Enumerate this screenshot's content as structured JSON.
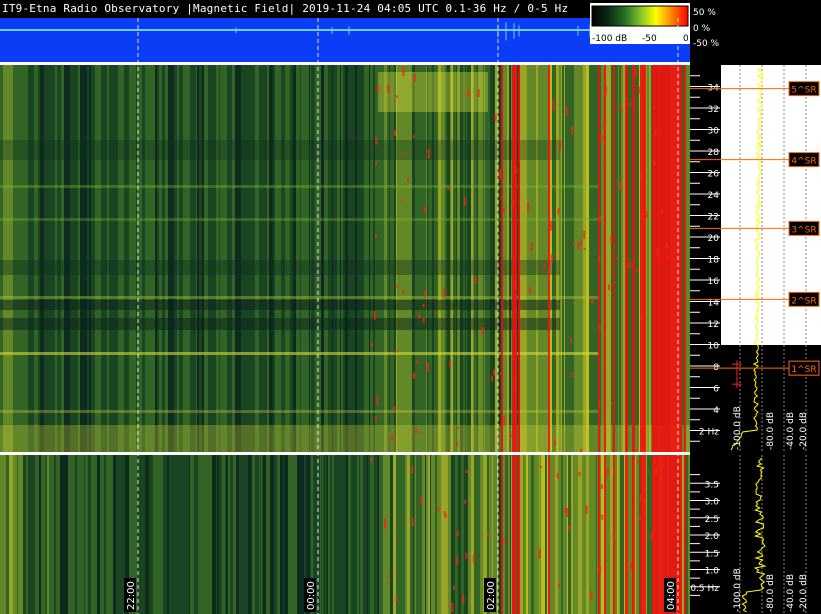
{
  "header": {
    "title": "IT9-Etna Radio Observatory |Magnetic Field| 2019-11-24 04:05 UTC 0.1-36 Hz / 0-5 Hz"
  },
  "colorbar": {
    "labels": [
      "-100 dB",
      "-50",
      "0"
    ],
    "gradient": [
      "#000000",
      "#0a2a12",
      "#1f6e22",
      "#7fbf2a",
      "#ffff00",
      "#ff8000",
      "#ff0000"
    ]
  },
  "top_strip": {
    "percent_labels": [
      "50 %",
      "0 %",
      "-50 %"
    ],
    "colors": {
      "bg": "#0a3df5",
      "line": "#6fd0ff"
    }
  },
  "colors": {
    "marker": "#ff6a00",
    "profile": "#ffff00",
    "grid": "#ffffff"
  },
  "chart_data": [
    {
      "type": "heatmap",
      "title": "",
      "ylabel": "Hz",
      "y_unit_label": "Hz",
      "ylim": [
        0,
        36
      ],
      "y_ticks": [
        2,
        4,
        6,
        8,
        10,
        12,
        14,
        16,
        18,
        20,
        22,
        24,
        26,
        28,
        30,
        32,
        34
      ],
      "x_time_labels": [
        "22:00",
        "00:00",
        "02:00",
        "04:00"
      ],
      "schumann_resonances": [
        {
          "label": "1^SR",
          "freq_hz": 7.8
        },
        {
          "label": "2^SR",
          "freq_hz": 14.2
        },
        {
          "label": "3^SR",
          "freq_hz": 20.8
        },
        {
          "label": "4^SR",
          "freq_hz": 27.2
        },
        {
          "label": "5^SR",
          "freq_hz": 33.8
        }
      ],
      "profile_xlabels": [
        "-100.0 dB",
        "-80.0 dB",
        "-40.0 dB",
        "-20.0 dB"
      ]
    },
    {
      "type": "heatmap",
      "title": "",
      "ylabel": "Hz",
      "y_unit_label": "Hz",
      "ylim": [
        0,
        4
      ],
      "y_ticks": [
        0.5,
        1.0,
        1.5,
        2.0,
        2.5,
        3.0,
        3.5
      ],
      "x_time_labels": [
        "22:00",
        "00:00",
        "02:00",
        "04:00"
      ],
      "profile_xlabels": [
        "-100.0 dB",
        "-80.0 dB",
        "-40.0 dB",
        "-20.0 dB"
      ]
    }
  ]
}
